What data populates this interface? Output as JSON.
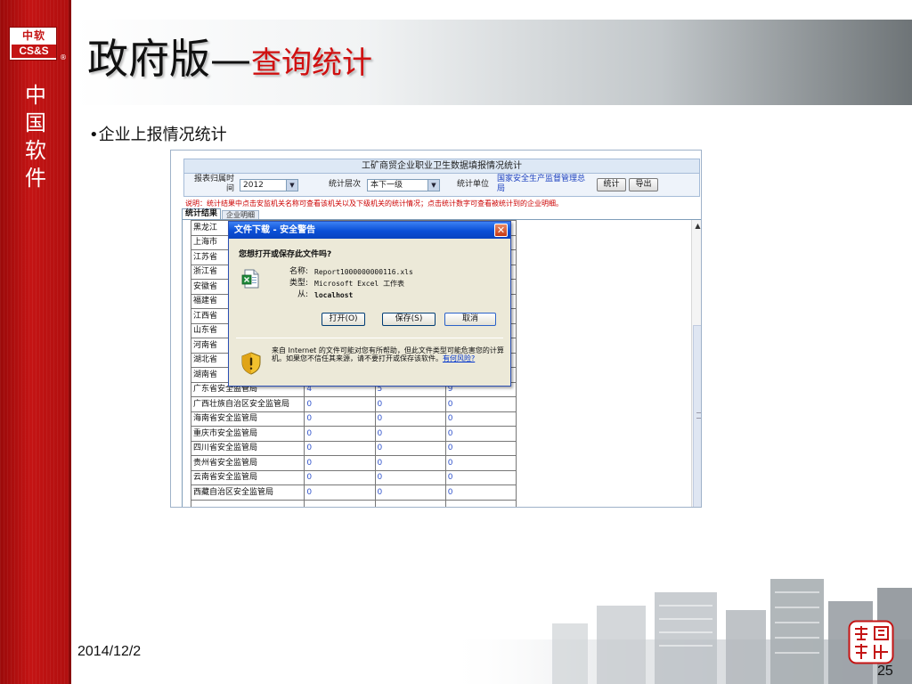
{
  "slide": {
    "title_main": "政府版—",
    "title_sub": "查询统计",
    "bullet": "•企业上报情况统计",
    "date": "2014/12/2",
    "page_number": "25",
    "left_band": {
      "logo_top": "中软",
      "logo_bottom": "CS&S",
      "logo_mark": "®",
      "chars": [
        "中",
        "国",
        "软",
        "件"
      ]
    }
  },
  "app": {
    "form_title": "工矿商贸企业职业卫生数据填报情况统计",
    "period_label": "报表归属时间",
    "period_value": "2012",
    "level_label": "统计层次",
    "level_value": "本下一级",
    "unit_label": "统计单位",
    "unit_value": "国家安全生产监督管理总局",
    "stat_button": "统计",
    "export_button": "导出",
    "note": "说明：统计结果中点击安监机关名称可查看该机关以及下级机关的统计情况；点击统计数字可查看被统计到的企业明细。",
    "tab_results": "统计结果",
    "tab_details": "企业明细",
    "table_rows": [
      {
        "name": "黑龙江",
        "a": "",
        "b": "",
        "c": ""
      },
      {
        "name": "上海市",
        "a": "",
        "b": "",
        "c": ""
      },
      {
        "name": "江苏省",
        "a": "",
        "b": "",
        "c": ""
      },
      {
        "name": "浙江省",
        "a": "",
        "b": "",
        "c": ""
      },
      {
        "name": "安徽省",
        "a": "",
        "b": "",
        "c": ""
      },
      {
        "name": "福建省",
        "a": "",
        "b": "",
        "c": ""
      },
      {
        "name": "江西省",
        "a": "",
        "b": "",
        "c": ""
      },
      {
        "name": "山东省",
        "a": "",
        "b": "",
        "c": ""
      },
      {
        "name": "河南省",
        "a": "",
        "b": "",
        "c": ""
      },
      {
        "name": "湖北省",
        "a": "",
        "b": "",
        "c": ""
      },
      {
        "name": "湖南省",
        "a": "",
        "b": "",
        "c": ""
      },
      {
        "name": "广东省安全监管局",
        "a": "4",
        "b": "5",
        "c": "9"
      },
      {
        "name": "广西壮族自治区安全监管局",
        "a": "0",
        "b": "0",
        "c": "0"
      },
      {
        "name": "海南省安全监管局",
        "a": "0",
        "b": "0",
        "c": "0"
      },
      {
        "name": "重庆市安全监管局",
        "a": "0",
        "b": "0",
        "c": "0"
      },
      {
        "name": "四川省安全监管局",
        "a": "0",
        "b": "0",
        "c": "0"
      },
      {
        "name": "贵州省安全监管局",
        "a": "0",
        "b": "0",
        "c": "0"
      },
      {
        "name": "云南省安全监管局",
        "a": "0",
        "b": "0",
        "c": "0"
      },
      {
        "name": "西藏自治区安全监管局",
        "a": "0",
        "b": "0",
        "c": "0"
      },
      {
        "name": "",
        "a": "",
        "b": "",
        "c": ""
      }
    ]
  },
  "dialog": {
    "title": "文件下载 - 安全警告",
    "close": "✕",
    "question": "您想打开或保存此文件吗?",
    "name_label": "名称:",
    "name_value": "Report1000000000116.xls",
    "type_label": "类型:",
    "type_value": "Microsoft Excel 工作表",
    "from_label": "从:",
    "from_value": "localhost",
    "open_button": "打开(O)",
    "save_button": "保存(S)",
    "cancel_button": "取消",
    "warning": "来自 Internet 的文件可能对您有所帮助，但此文件类型可能危害您的计算机。如果您不信任其来源，请不要打开或保存该软件。",
    "risk_link": "有何风险?"
  },
  "colors": {
    "band_red": "#c41414",
    "title_red": "#d01010",
    "xp_blue": "#0a4fd6",
    "note_red": "#cc0000",
    "number_blue": "#3355cc"
  }
}
